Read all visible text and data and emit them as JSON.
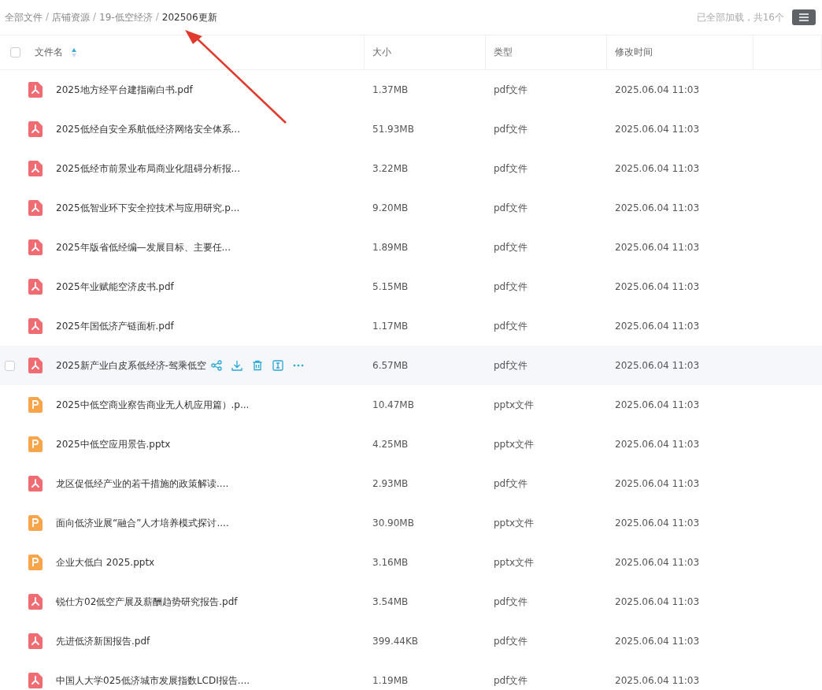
{
  "breadcrumb": [
    {
      "label": "全部文件",
      "current": false
    },
    {
      "separator": "/",
      "label": "店铺资源",
      "current": false
    },
    {
      "separator": "/",
      "label": "19-低空经济",
      "current": false
    },
    {
      "separator": "/",
      "label": "202506更新",
      "current": true
    }
  ],
  "select_all": {
    "checked": false
  },
  "status": "已全部加载，共16个",
  "table": {
    "columns": [
      "文件名",
      "大小",
      "类型",
      "修改时间"
    ],
    "rows": [
      {
        "kind": "pdf",
        "name": "2025地方经平台建指南白书.pdf",
        "size": "1.37MB",
        "type": "pdf文件",
        "time": "2025.06.04 11:03",
        "hovered": false
      },
      {
        "kind": "pdf",
        "name": "2025低经自安全系航低经济网络安全体系...",
        "size": "51.93MB",
        "type": "pdf文件",
        "time": "2025.06.04 11:03",
        "hovered": false
      },
      {
        "kind": "pdf",
        "name": "2025低经市前景业布局商业化阻碍分析报...",
        "size": "3.22MB",
        "type": "pdf文件",
        "time": "2025.06.04 11:03",
        "hovered": false
      },
      {
        "kind": "pdf",
        "name": "2025低智业环下安全控技术与应用研究.p...",
        "size": "9.20MB",
        "type": "pdf文件",
        "time": "2025.06.04 11:03",
        "hovered": false
      },
      {
        "kind": "pdf",
        "name": "2025年版省低经编—发展目标、主要任...",
        "size": "1.89MB",
        "type": "pdf文件",
        "time": "2025.06.04 11:03",
        "hovered": false
      },
      {
        "kind": "pdf",
        "name": "2025年业赋能空济皮书.pdf",
        "size": "5.15MB",
        "type": "pdf文件",
        "time": "2025.06.04 11:03",
        "hovered": false
      },
      {
        "kind": "pdf",
        "name": "2025年国低济产链面析.pdf",
        "size": "1.17MB",
        "type": "pdf文件",
        "time": "2025.06.04 11:03",
        "hovered": false
      },
      {
        "kind": "pdf",
        "name": "2025新产业白皮系低经济-驾乘低空",
        "size": "6.57MB",
        "type": "pdf文件",
        "time": "2025.06.04 11:03",
        "hovered": true
      },
      {
        "kind": "pptx",
        "name": "2025中低空商业察告商业无人机应用篇）.p...",
        "size": "10.47MB",
        "type": "pptx文件",
        "time": "2025.06.04 11:03",
        "hovered": false
      },
      {
        "kind": "pptx",
        "name": "2025中低空应用景告.pptx",
        "size": "4.25MB",
        "type": "pptx文件",
        "time": "2025.06.04 11:03",
        "hovered": false
      },
      {
        "kind": "pdf",
        "name": "龙区促低经产业的若干措施的政策解读....",
        "size": "2.93MB",
        "type": "pdf文件",
        "time": "2025.06.04 11:03",
        "hovered": false
      },
      {
        "kind": "pptx",
        "name": "面向低济业展“融合”人才培养模式探讨....",
        "size": "30.90MB",
        "type": "pptx文件",
        "time": "2025.06.04 11:03",
        "hovered": false
      },
      {
        "kind": "pptx",
        "name": "企业大低白 2025.pptx",
        "size": "3.16MB",
        "type": "pptx文件",
        "time": "2025.06.04 11:03",
        "hovered": false
      },
      {
        "kind": "pdf",
        "name": "锐仕方02低空产展及薪酬趋势研究报告.pdf",
        "size": "3.54MB",
        "type": "pdf文件",
        "time": "2025.06.04 11:03",
        "hovered": false
      },
      {
        "kind": "pdf",
        "name": "先进低济新国报告.pdf",
        "size": "399.44KB",
        "type": "pdf文件",
        "time": "2025.06.04 11:03",
        "hovered": false
      },
      {
        "kind": "pdf",
        "name": "中国人大学025低济城市发展指数LCDI报告....",
        "size": "1.19MB",
        "type": "pdf文件",
        "time": "2025.06.04 11:03",
        "hovered": false
      }
    ]
  }
}
